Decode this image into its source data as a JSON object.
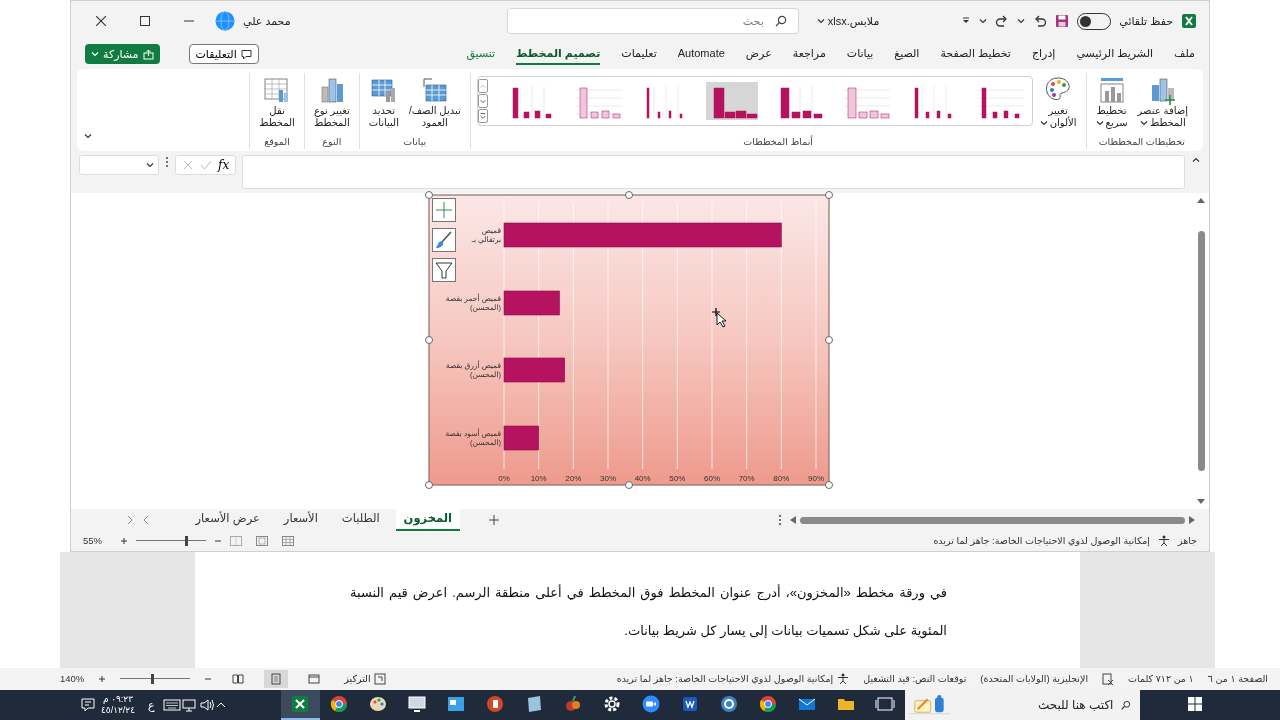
{
  "title_bar": {
    "autosave_label": "حفظ تلقائي",
    "autosave_on": false,
    "file_name": "ملابس.xlsx",
    "search_placeholder": "بحث",
    "user_name": "محمد علي"
  },
  "ribbon_tabs": [
    {
      "label": "ملف",
      "selected": false,
      "kind": "normal"
    },
    {
      "label": "الشريط الرئيسي",
      "selected": false,
      "kind": "normal"
    },
    {
      "label": "إدراج",
      "selected": false,
      "kind": "normal"
    },
    {
      "label": "تخطيط الصفحة",
      "selected": false,
      "kind": "normal"
    },
    {
      "label": "الصيغ",
      "selected": false,
      "kind": "normal"
    },
    {
      "label": "بيانات",
      "selected": false,
      "kind": "normal"
    },
    {
      "label": "مراجعة",
      "selected": false,
      "kind": "normal"
    },
    {
      "label": "عرض",
      "selected": false,
      "kind": "normal"
    },
    {
      "label": "Automate",
      "selected": false,
      "kind": "normal"
    },
    {
      "label": "تعليمات",
      "selected": false,
      "kind": "normal"
    },
    {
      "label": "تصميم المخطط",
      "selected": true,
      "kind": "contextual"
    },
    {
      "label": "تنسيق",
      "selected": false,
      "kind": "contextual"
    }
  ],
  "comments_button": "التعليقات",
  "share_button": "مشاركة",
  "ribbon_groups": [
    {
      "label": "تخطيطات المخططات",
      "commands": [
        {
          "lines": [
            "إضافة عنصر",
            "المخطط"
          ],
          "dropdown": true
        },
        {
          "lines": [
            "تخطيط",
            "سريع"
          ],
          "dropdown": true
        }
      ]
    },
    {
      "label": "أنماط المخططات",
      "commands": [
        {
          "lines": [
            "تغيير",
            "الألوان"
          ],
          "dropdown": true
        }
      ]
    },
    {
      "label": "بيانات",
      "commands": [
        {
          "lines": [
            "تبديل الصف/",
            "العمود"
          ],
          "dropdown": false
        },
        {
          "lines": [
            "تحديد",
            "البيانات"
          ],
          "dropdown": false
        }
      ]
    },
    {
      "label": "النوع",
      "commands": [
        {
          "lines": [
            "تغيير نوع",
            "المخطط"
          ],
          "dropdown": false
        }
      ]
    },
    {
      "label": "الموقع",
      "commands": [
        {
          "lines": [
            "نقل",
            "المخطط"
          ],
          "dropdown": false
        }
      ]
    }
  ],
  "formula_bar": {
    "function_label": "fx"
  },
  "chart": {
    "chart_data": {
      "type": "bar",
      "orientation": "horizontal",
      "categories": [
        "قميص برتقالي بـ",
        "قميص أحمر بقصة (المحسن)",
        "قميص أزرق بقصة (المحسن)",
        "قميص أسود بقصة (المحسن)"
      ],
      "values": [
        0.8,
        0.16,
        0.175,
        0.1
      ],
      "xlim": [
        0,
        0.9
      ],
      "grid": true,
      "xticks": [
        {
          "value": 0,
          "label": "0%"
        },
        {
          "value": 0.1,
          "label": "10%"
        },
        {
          "value": 0.2,
          "label": "20%"
        },
        {
          "value": 0.3,
          "label": "30%"
        },
        {
          "value": 0.4,
          "label": "40%"
        },
        {
          "value": 0.5,
          "label": "50%"
        },
        {
          "value": 0.6,
          "label": "60%"
        },
        {
          "value": 0.7,
          "label": "70%"
        },
        {
          "value": 0.8,
          "label": "80%"
        },
        {
          "value": 0.9,
          "label": "90%"
        }
      ]
    }
  },
  "sheet_tabs": [
    {
      "label": "المخزون",
      "selected": true
    },
    {
      "label": "الطلبات",
      "selected": false
    },
    {
      "label": "الأسعار",
      "selected": false
    },
    {
      "label": "عرض الأسعار",
      "selected": false
    }
  ],
  "excel_status": {
    "ready": "جاهز",
    "accessibility": "إمكانية الوصول لذوي الاحتياجات الخاصة: جاهز لما تريده",
    "zoom": "55%"
  },
  "document": {
    "paragraph": "في ورقة مخطط «المخزون»، أدرج عنوان المخطط فوق المخطط في أعلى منطقة الرسم. اعرض قيم النسبة المئوية على شكل تسميات بيانات إلى يسار كل شريط بيانات."
  },
  "word_status": {
    "page": "الصفحة ١ من ٦",
    "words": "١ من ٧١٢ كلمات",
    "language": "الإنجليزية (الولايات المتحدة)",
    "predictions": "توقعات النص: قيد التشغيل",
    "accessibility": "إمكانية الوصول لذوي الاحتياجات الخاصة: جاهز لما تريده",
    "focus": "التركيز",
    "views": [
      {
        "selected": false
      },
      {
        "selected": true
      },
      {
        "selected": false
      }
    ],
    "zoom": "140%"
  },
  "taskbar": {
    "time": "٠٩:٢٣ م",
    "date": "٤٥/١٢/٢٤",
    "input_language": "ع",
    "apps": [
      {
        "selected": true
      },
      {
        "selected": false
      },
      {
        "selected": false
      },
      {
        "selected": false
      },
      {
        "selected": false
      },
      {
        "selected": false
      },
      {
        "selected": false
      },
      {
        "selected": false
      },
      {
        "selected": false
      },
      {
        "selected": false
      },
      {
        "selected": false
      },
      {
        "selected": false
      },
      {
        "selected": false
      },
      {
        "selected": false
      },
      {
        "selected": false
      },
      {
        "selected": false
      }
    ],
    "search_placeholder": "اكتب هنا للبحث"
  }
}
